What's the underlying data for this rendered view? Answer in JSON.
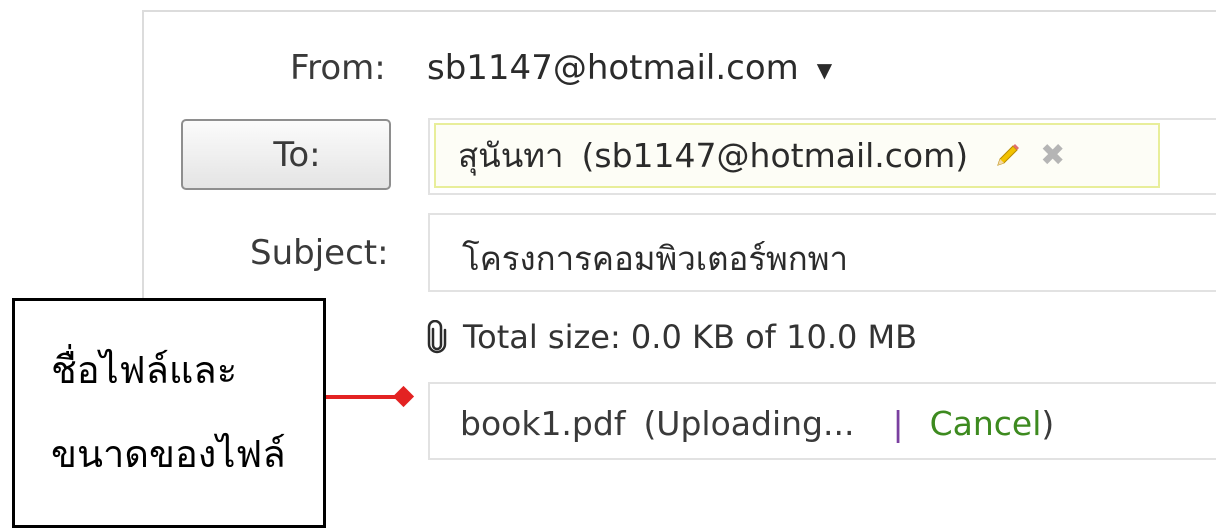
{
  "from": {
    "label": "From:",
    "value": "sb1147@hotmail.com",
    "caret": "▼"
  },
  "to": {
    "button_label": "To:",
    "recipient_name": "สุนันทา",
    "recipient_email": "(sb1147@hotmail.com)",
    "remove_glyph": "✖"
  },
  "subject": {
    "label": "Subject:",
    "value": "โครงการคอมพิวเตอร์พกพา"
  },
  "attachment": {
    "total_size": "Total size: 0.0 KB of 10.0 MB",
    "file_name": "book1.pdf",
    "status": "(Uploading...",
    "separator": "|",
    "cancel_label": "Cancel",
    "close_paren": ")"
  },
  "callout": {
    "line1": "ชื่อไฟล์และ",
    "line2": "ขนาดของไฟล์"
  },
  "colors": {
    "cancel": "#3d8a1f",
    "recipient_border": "#e8ee9a",
    "arrow": "#e32222"
  },
  "icons": {
    "edit": "pencil-icon",
    "attach": "paperclip-icon",
    "remove": "close-icon"
  }
}
